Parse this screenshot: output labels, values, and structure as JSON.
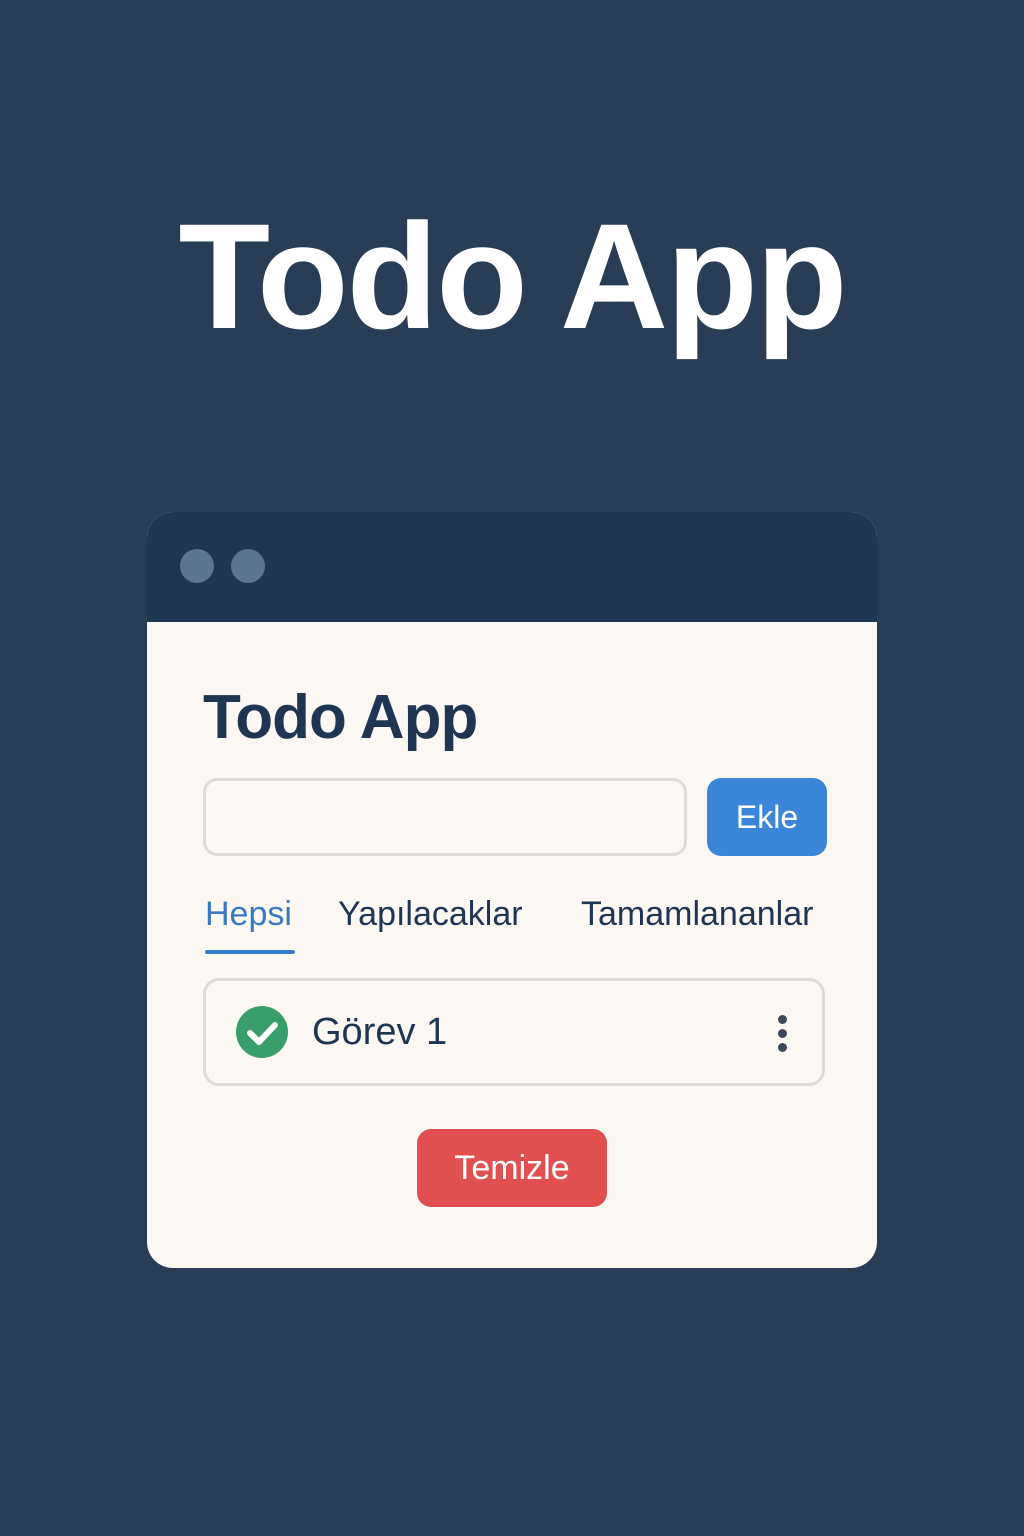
{
  "hero": {
    "title": "Todo App"
  },
  "app": {
    "heading": "Todo App",
    "input": {
      "value": "",
      "placeholder": ""
    },
    "add_label": "Ekle",
    "tabs": [
      {
        "label": "Hepsi",
        "active": true
      },
      {
        "label": "Yapılacaklar",
        "active": false
      },
      {
        "label": "Tamamlananlar",
        "active": false
      }
    ],
    "todos": [
      {
        "text": "Görev 1",
        "done": true,
        "icon": "check-circle-icon"
      }
    ],
    "clear_label": "Temizle"
  },
  "colors": {
    "background": "#2a3d56",
    "titlebar": "#1f3551",
    "card": "#fbf8f4",
    "accent": "#3b86d8",
    "active_tab": "#3b78c2",
    "success": "#3a9e6a",
    "danger": "#e1504f"
  }
}
